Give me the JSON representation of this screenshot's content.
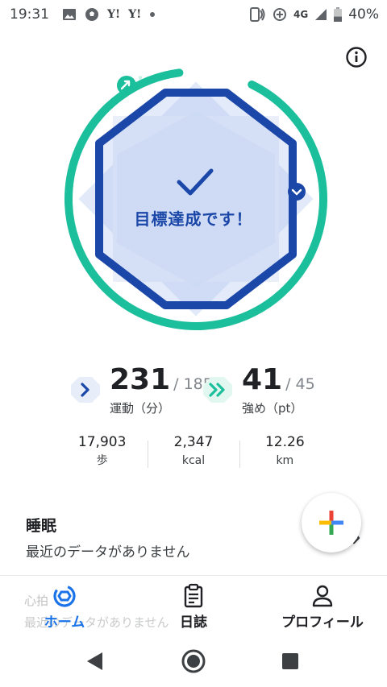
{
  "status_bar": {
    "time": "19:31",
    "left_icons": [
      "image-icon",
      "soccer-ball-icon",
      "yahoo-icon",
      "yahoo-icon",
      "dot-icon"
    ],
    "yahoo_label": "Y!",
    "network": "4G",
    "battery_percent": "40%",
    "battery_level": 0.4
  },
  "ring": {
    "message": "目標達成です！",
    "ring_color": "#1cbf9c",
    "shape_color": "#1a47a8"
  },
  "stats": {
    "move_minutes": {
      "value": "231",
      "goal": "/ 185",
      "label": "運動（分）"
    },
    "heart_points": {
      "value": "41",
      "goal": "/ 45",
      "label": "強め（pt）"
    }
  },
  "metrics": [
    {
      "value": "17,903",
      "unit": "歩"
    },
    {
      "value": "2,347",
      "unit": "kcal"
    },
    {
      "value": "12.26",
      "unit": "km"
    }
  ],
  "sleep": {
    "title": "睡眠",
    "subtitle": "最近のデータがありません"
  },
  "ghost_card": {
    "title": "心拍",
    "subtitle": "最近のデータがありません"
  },
  "nav": [
    {
      "label": "ホーム",
      "icon": "home-ring-icon",
      "active": true
    },
    {
      "label": "日誌",
      "icon": "journal-icon",
      "active": false
    },
    {
      "label": "プロフィール",
      "icon": "profile-icon",
      "active": false
    }
  ],
  "colors": {
    "accent_blue": "#1a73e8",
    "teal": "#1cbf9c",
    "navy": "#1a47a8"
  }
}
